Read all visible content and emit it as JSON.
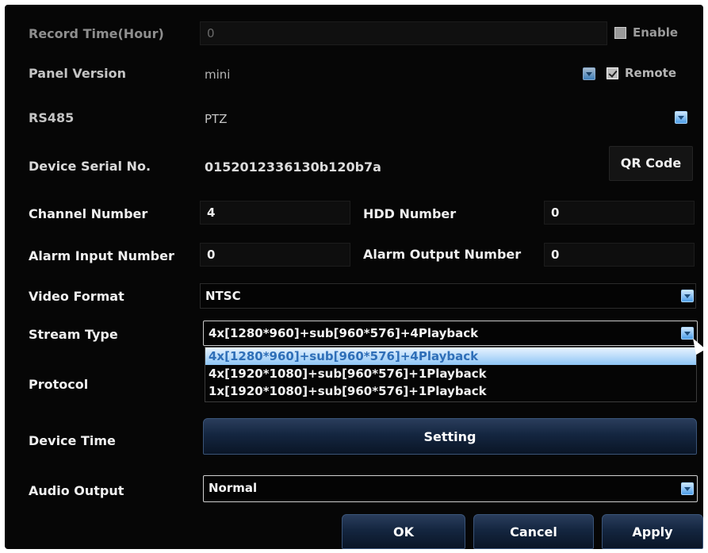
{
  "record_time": {
    "label": "Record Time(Hour)",
    "value": "0",
    "enable_label": "Enable",
    "enable_checked": false
  },
  "panel_version": {
    "label": "Panel Version",
    "value": "mini",
    "remote_label": "Remote",
    "remote_checked": true
  },
  "rs485": {
    "label": "RS485",
    "value": "PTZ"
  },
  "device_serial": {
    "label": "Device Serial No.",
    "value": "0152012336130b120b7a",
    "qr_button": "QR Code"
  },
  "channel_number": {
    "label": "Channel Number",
    "value": "4"
  },
  "hdd_number": {
    "label": "HDD Number",
    "value": "0"
  },
  "alarm_input": {
    "label": "Alarm Input Number",
    "value": "0"
  },
  "alarm_output": {
    "label": "Alarm Output Number",
    "value": "0"
  },
  "video_format": {
    "label": "Video Format",
    "value": "NTSC"
  },
  "stream_type": {
    "label": "Stream Type",
    "value": "4x[1280*960]+sub[960*576]+4Playback",
    "options": [
      "4x[1280*960]+sub[960*576]+4Playback",
      "4x[1920*1080]+sub[960*576]+1Playback",
      "1x[1920*1080]+sub[960*576]+1Playback"
    ],
    "selected_index": 0
  },
  "protocol": {
    "label": "Protocol"
  },
  "device_time": {
    "label": "Device Time",
    "button": "Setting"
  },
  "audio_output": {
    "label": "Audio Output",
    "value": "Normal"
  },
  "footer": {
    "ok": "OK",
    "cancel": "Cancel",
    "apply": "Apply"
  },
  "colors": {
    "accent": "#4d9ee8",
    "button_top": "#2a3d5c",
    "button_bottom": "#0a1526"
  },
  "icons": [
    "dropdown-arrow-icon",
    "checkbox-icon",
    "mouse-cursor-icon"
  ]
}
